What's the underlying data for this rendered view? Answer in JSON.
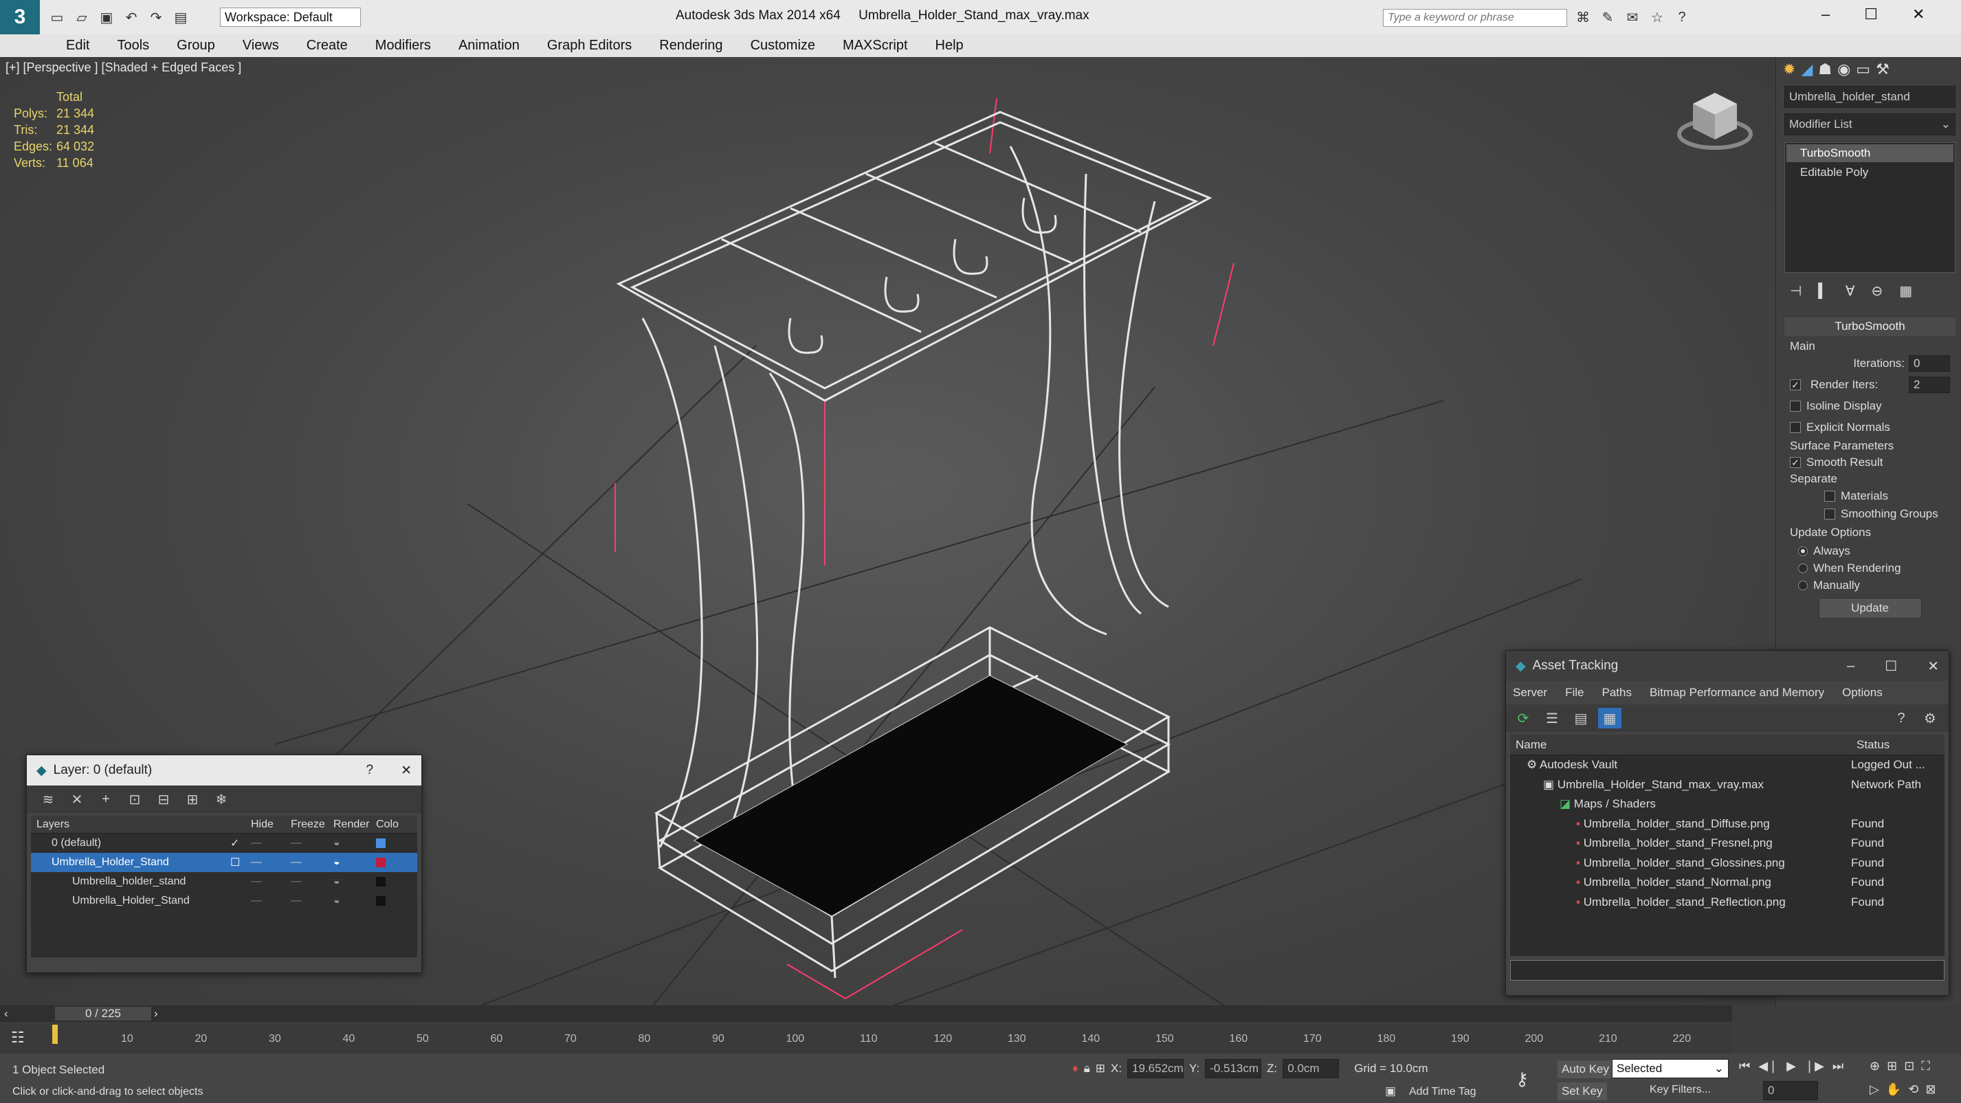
{
  "window": {
    "app_title": "Autodesk 3ds Max  2014 x64",
    "file_name": "Umbrella_Holder_Stand_max_vray.max",
    "workspace": "Workspace: Default",
    "search_placeholder": "Type a keyword or phrase"
  },
  "menu": [
    "Edit",
    "Tools",
    "Group",
    "Views",
    "Create",
    "Modifiers",
    "Animation",
    "Graph Editors",
    "Rendering",
    "Customize",
    "MAXScript",
    "Help"
  ],
  "viewport": {
    "label": "[+] [Perspective ] [Shaded + Edged Faces ]",
    "stats": {
      "header": "Total",
      "rows": [
        {
          "label": "Polys:",
          "value": "21 344"
        },
        {
          "label": "Tris:",
          "value": "21 344"
        },
        {
          "label": "Edges:",
          "value": "64 032"
        },
        {
          "label": "Verts:",
          "value": "11 064"
        }
      ]
    }
  },
  "command_panel": {
    "object_name": "Umbrella_holder_stand",
    "modifier_list": "Modifier List",
    "stack": [
      "TurboSmooth",
      "Editable Poly"
    ],
    "rollout_title": "TurboSmooth",
    "main_group": "Main",
    "iterations_label": "Iterations:",
    "iterations_value": "0",
    "render_iters_label": "Render Iters:",
    "render_iters_value": "2",
    "isoline": "Isoline Display",
    "explicit_normals": "Explicit Normals",
    "surface_params": "Surface Parameters",
    "smooth_result": "Smooth Result",
    "separate": "Separate",
    "materials": "Materials",
    "smoothing_groups": "Smoothing Groups",
    "update_options": "Update Options",
    "always": "Always",
    "when_rendering": "When Rendering",
    "manually": "Manually",
    "update_btn": "Update"
  },
  "layer_dialog": {
    "title": "Layer: 0 (default)",
    "help": "?",
    "headers": [
      "Layers",
      "Hide",
      "Freeze",
      "Render",
      "Colo"
    ],
    "rows": [
      {
        "name": "0 (default)",
        "color": "#4a8fe0",
        "level": 1
      },
      {
        "name": "Umbrella_Holder_Stand",
        "color": "#c01e3c",
        "level": 1
      },
      {
        "name": "Umbrella_holder_stand",
        "color": "#111111",
        "level": 2
      },
      {
        "name": "Umbrella_Holder_Stand",
        "color": "#111111",
        "level": 2
      }
    ]
  },
  "asset_tracking": {
    "title": "Asset Tracking",
    "menu": [
      "Server",
      "File",
      "Paths",
      "Bitmap Performance and Memory",
      "Options"
    ],
    "headers": [
      "Name",
      "Status"
    ],
    "rows": [
      {
        "name": "Autodesk Vault",
        "status": "Logged Out ...",
        "level": 1
      },
      {
        "name": "Umbrella_Holder_Stand_max_vray.max",
        "status": "Network Path",
        "level": 2
      },
      {
        "name": "Maps / Shaders",
        "status": "",
        "level": 3
      },
      {
        "name": "Umbrella_holder_stand_Diffuse.png",
        "status": "Found",
        "level": 4
      },
      {
        "name": "Umbrella_holder_stand_Fresnel.png",
        "status": "Found",
        "level": 4
      },
      {
        "name": "Umbrella_holder_stand_Glossines.png",
        "status": "Found",
        "level": 4
      },
      {
        "name": "Umbrella_holder_stand_Normal.png",
        "status": "Found",
        "level": 4
      },
      {
        "name": "Umbrella_holder_stand_Reflection.png",
        "status": "Found",
        "level": 4
      }
    ]
  },
  "timeline": {
    "frame": "0 / 225",
    "ticks": [
      "10",
      "20",
      "30",
      "40",
      "50",
      "60",
      "70",
      "80",
      "90",
      "100",
      "110",
      "120",
      "130",
      "140",
      "150",
      "160",
      "170",
      "180",
      "190",
      "200",
      "210",
      "220"
    ]
  },
  "status": {
    "selected": "1 Object Selected",
    "prompt": "Click or click-and-drag to select objects",
    "x_label": "X:",
    "x_value": "19.652cm",
    "y_label": "Y:",
    "y_value": "-0.513cm",
    "z_label": "Z:",
    "z_value": "0.0cm",
    "grid": "Grid = 10.0cm",
    "auto_key": "Auto Key",
    "selected_dropdown": "Selected",
    "set_key": "Set Key",
    "key_filters": "Key Filters...",
    "add_time_tag": "Add Time Tag",
    "frame_value": "0"
  }
}
